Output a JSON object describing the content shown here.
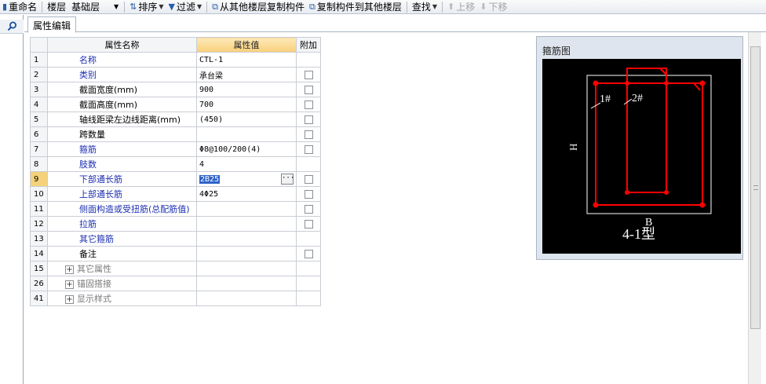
{
  "toolbar": {
    "rename": "重命名",
    "floor_label": "楼层",
    "floor_value": "基础层",
    "sort": "排序",
    "filter": "过滤",
    "copy_from": "从其他楼层复制构件",
    "copy_to": "复制构件到其他楼层",
    "find": "查找",
    "move_up": "上移",
    "move_down": "下移"
  },
  "tab": {
    "label": "属性编辑"
  },
  "grid": {
    "headers": {
      "name": "属性名称",
      "value": "属性值",
      "add": "附加"
    },
    "rows": [
      {
        "num": "1",
        "name": "名称",
        "value": "CTL-1"
      },
      {
        "num": "2",
        "name": "类别",
        "value": "承台梁"
      },
      {
        "num": "3",
        "name": "截面宽度(mm)",
        "value": "900"
      },
      {
        "num": "4",
        "name": "截面高度(mm)",
        "value": "700"
      },
      {
        "num": "5",
        "name": "轴线距梁左边线距离(mm)",
        "value": "(450)"
      },
      {
        "num": "6",
        "name": "跨数量",
        "value": ""
      },
      {
        "num": "7",
        "name": "箍筋",
        "value": "Φ8@100/200(4)"
      },
      {
        "num": "8",
        "name": "肢数",
        "value": "4"
      },
      {
        "num": "9",
        "name": "下部通长筋",
        "value": "2B25"
      },
      {
        "num": "10",
        "name": "上部通长筋",
        "value": "4Φ25"
      },
      {
        "num": "11",
        "name": "侧面构造或受扭筋(总配筋值)",
        "value": ""
      },
      {
        "num": "12",
        "name": "拉筋",
        "value": ""
      },
      {
        "num": "13",
        "name": "其它箍筋",
        "value": ""
      },
      {
        "num": "14",
        "name": "备注",
        "value": ""
      }
    ],
    "groups": [
      {
        "num": "15",
        "name": "其它属性"
      },
      {
        "num": "26",
        "name": "锚固搭接"
      },
      {
        "num": "41",
        "name": "显示样式"
      }
    ]
  },
  "diagram": {
    "title": "箍筋图",
    "label_1": "1#",
    "label_2": "2#",
    "label_h": "H",
    "label_b": "B",
    "caption": "4-1型",
    "colors": {
      "rebar": "#ff0000",
      "outline": "#ffffff",
      "background": "#000000"
    }
  }
}
